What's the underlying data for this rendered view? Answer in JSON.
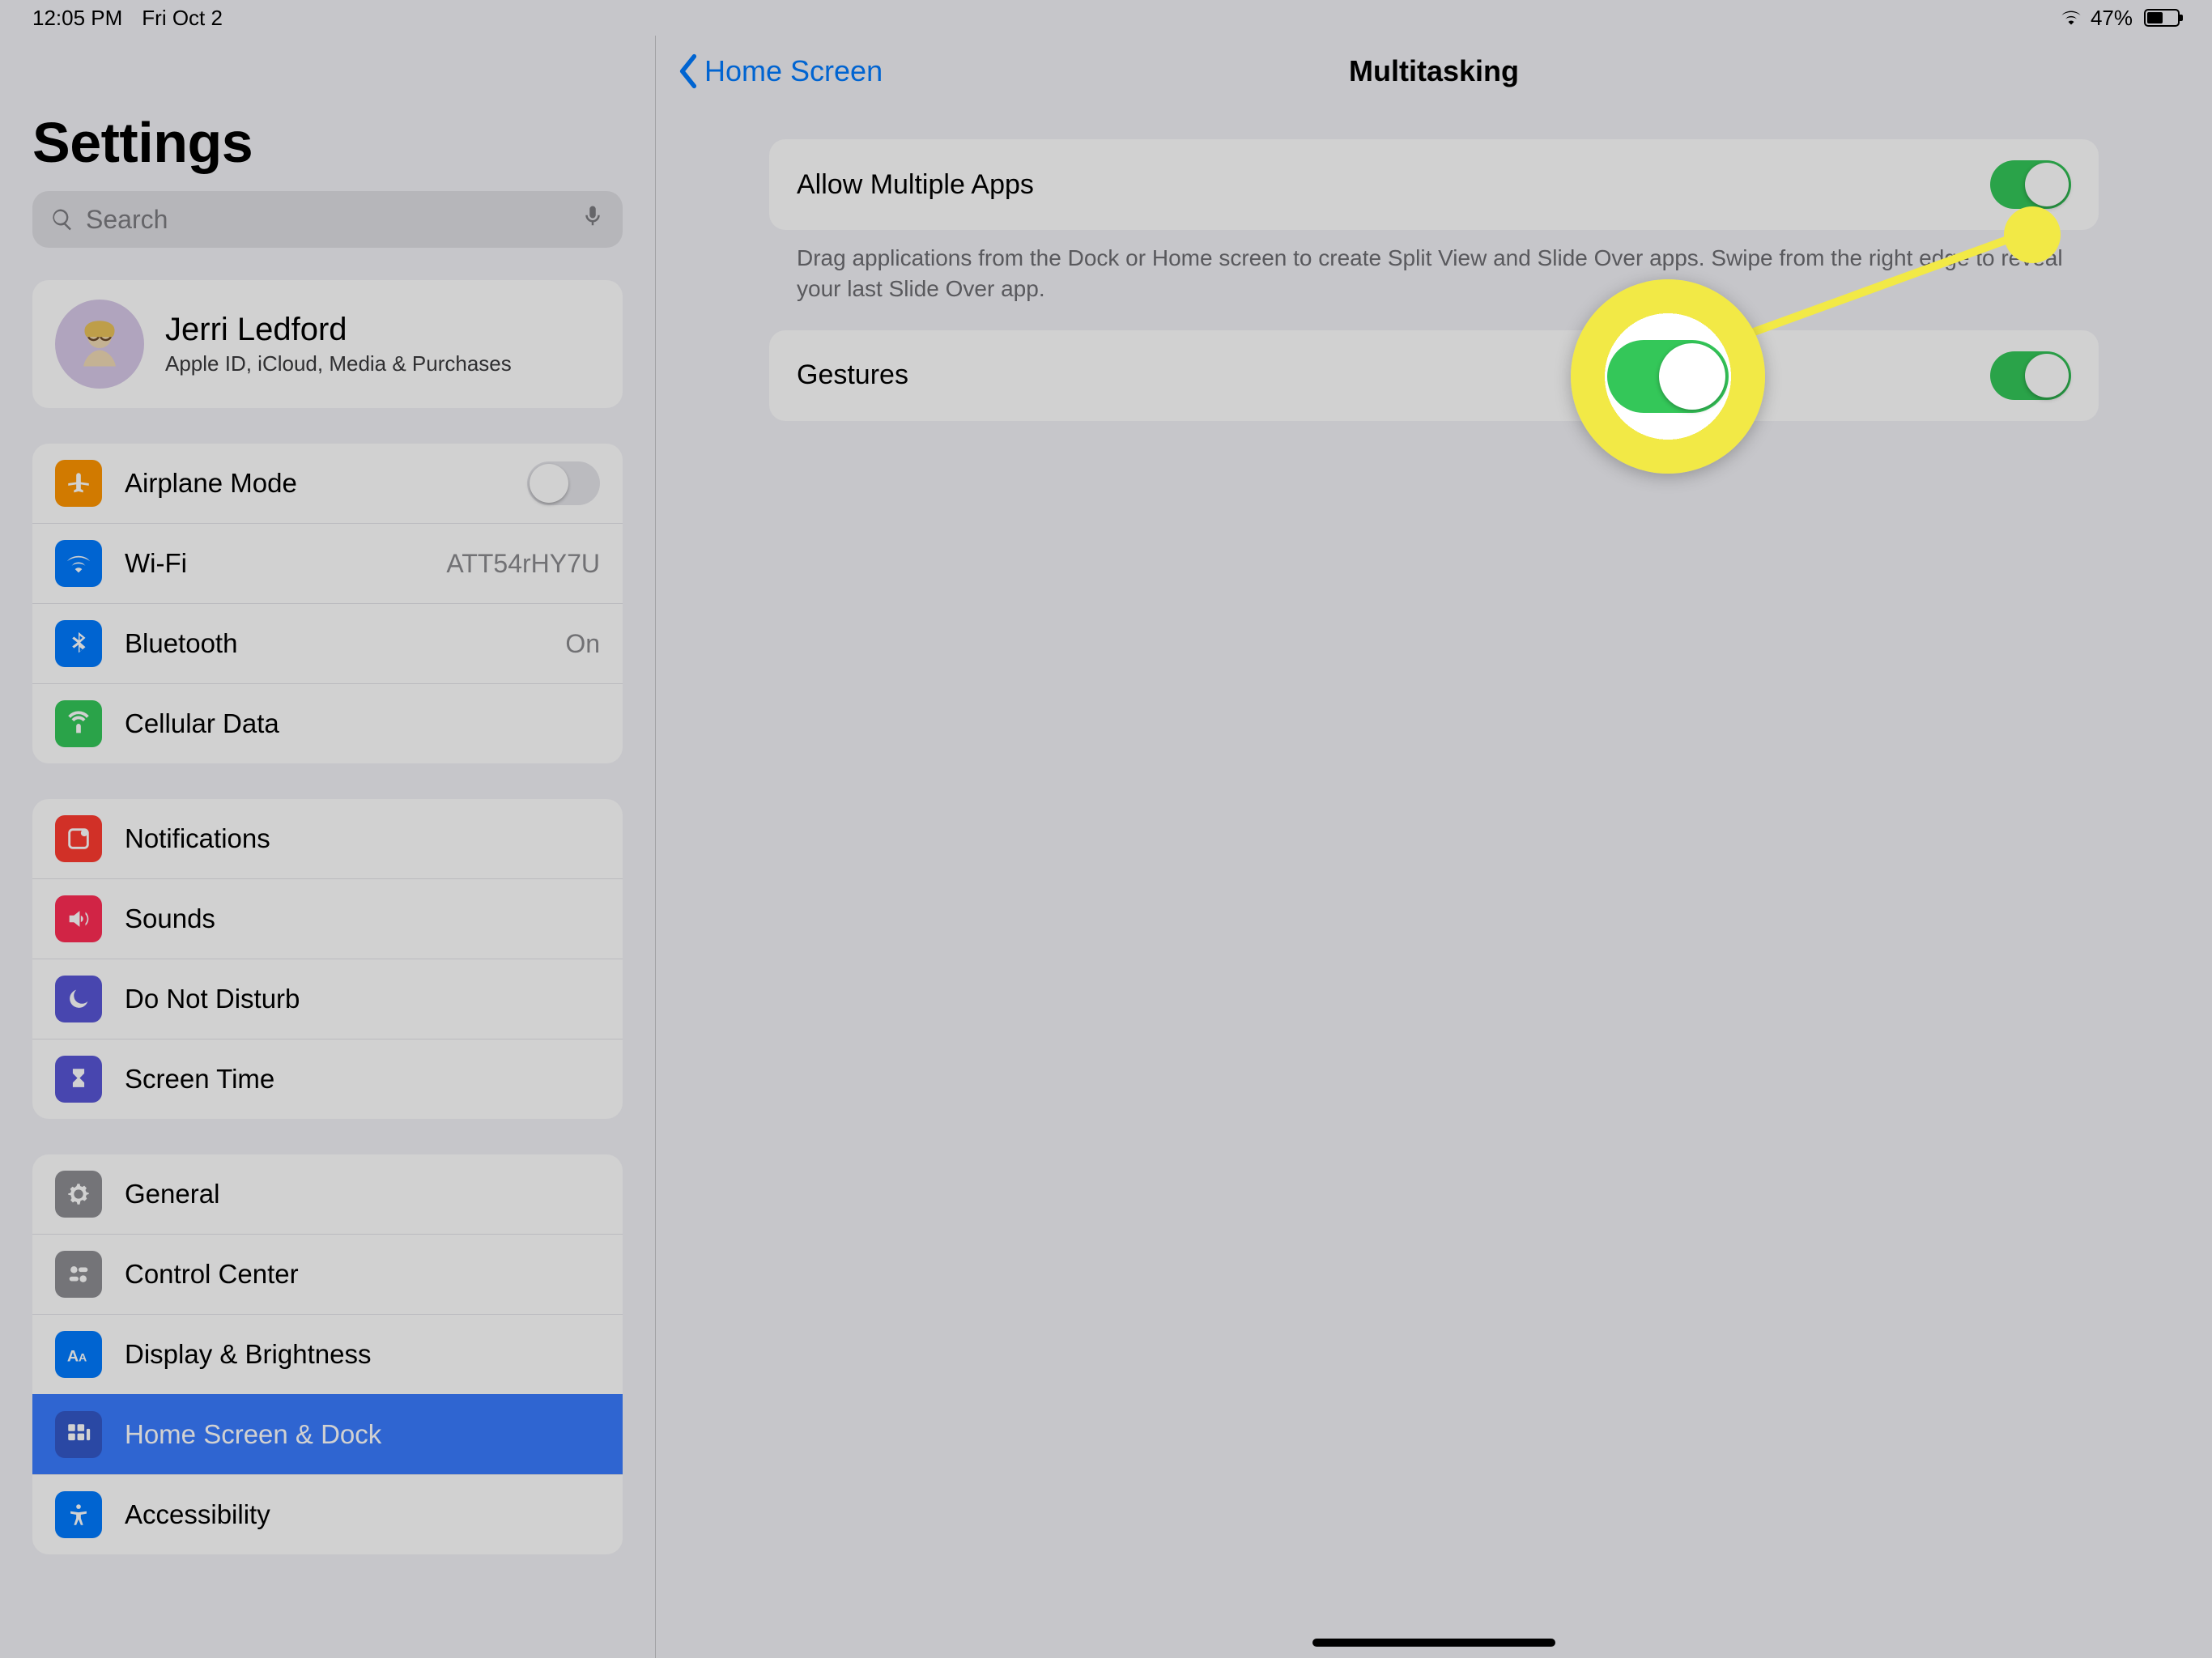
{
  "status": {
    "time": "12:05 PM",
    "date": "Fri Oct 2",
    "battery_pct": "47%"
  },
  "sidebar": {
    "title": "Settings",
    "search_placeholder": "Search",
    "user": {
      "name": "Jerri Ledford",
      "sub": "Apple ID, iCloud, Media & Purchases"
    },
    "group1": {
      "airplane": "Airplane Mode",
      "wifi": "Wi-Fi",
      "wifi_value": "ATT54rHY7U",
      "bluetooth": "Bluetooth",
      "bluetooth_value": "On",
      "cellular": "Cellular Data"
    },
    "group2": {
      "notifications": "Notifications",
      "sounds": "Sounds",
      "dnd": "Do Not Disturb",
      "screentime": "Screen Time"
    },
    "group3": {
      "general": "General",
      "control": "Control Center",
      "display": "Display & Brightness",
      "home": "Home Screen & Dock",
      "accessibility": "Accessibility"
    }
  },
  "detail": {
    "back_label": "Home Screen",
    "title": "Multitasking",
    "rows": {
      "allow_label": "Allow Multiple Apps",
      "allow_on": true,
      "allow_footer": "Drag applications from the Dock or Home screen to create Split View and Slide Over apps. Swipe from the right edge to reveal your last Slide Over app.",
      "gestures_label": "Gestures",
      "gestures_on": true
    }
  },
  "colors": {
    "accent_blue": "#007aff",
    "toggle_green": "#34c759",
    "highlight_yellow": "#f2e946"
  }
}
